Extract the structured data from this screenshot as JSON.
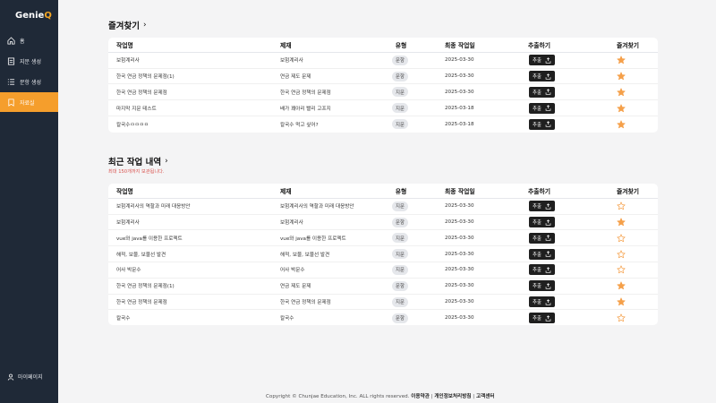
{
  "app": {
    "logo_main": "Genie",
    "logo_accent": "Q"
  },
  "sidebar": {
    "items": [
      {
        "label": "홈",
        "icon": "home-icon"
      },
      {
        "label": "지문 생성",
        "icon": "document-icon"
      },
      {
        "label": "문항 생성",
        "icon": "list-icon"
      },
      {
        "label": "자료실",
        "icon": "bookmark-icon",
        "active": true
      }
    ],
    "mypage": "마이페이지"
  },
  "favorites": {
    "title": "즐겨찾기",
    "headers": {
      "name": "작업명",
      "title": "제재",
      "type": "유형",
      "date": "최종 작업일",
      "export": "추출하기",
      "fav": "즐겨찾기"
    },
    "rows": [
      {
        "name": "보험계리사",
        "title": "보험계리사",
        "type": "문항",
        "date": "2025-03-30",
        "export": "추출",
        "fav": true
      },
      {
        "name": "한국 연금 정책의 문제점(1)",
        "title": "연금 제도 문제",
        "type": "문항",
        "date": "2025-03-30",
        "export": "추출",
        "fav": true
      },
      {
        "name": "한국 연금 정책의 문제점",
        "title": "한국 연금 정책의 문제점",
        "type": "지문",
        "date": "2025-03-30",
        "export": "추출",
        "fav": true
      },
      {
        "name": "마지막 지문 테스트",
        "title": "배가 꽤아리 빨리 고프지",
        "type": "지문",
        "date": "2025-03-18",
        "export": "추출",
        "fav": true
      },
      {
        "name": "칼국수ㅁㅁㅁㅁ",
        "title": "칼국수 먹고 싶어?",
        "type": "지문",
        "date": "2025-03-18",
        "export": "추출",
        "fav": true
      }
    ]
  },
  "recent": {
    "title": "최근 작업 내역",
    "note": "최대 150개까지 보관됩니다.",
    "headers": {
      "name": "작업명",
      "title": "제재",
      "type": "유형",
      "date": "최종 작업일",
      "export": "추출하기",
      "fav": "즐겨찾기"
    },
    "rows": [
      {
        "name": "보험계리사의 역할과 미래 대응방안",
        "title": "보험계리사의 역할과 미래 대응방안",
        "type": "지문",
        "date": "2025-03-30",
        "export": "추출",
        "fav": false
      },
      {
        "name": "보험계리사",
        "title": "보험계리사",
        "type": "문항",
        "date": "2025-03-30",
        "export": "추출",
        "fav": true
      },
      {
        "name": "vue와 java를 이용한 프로젝트",
        "title": "vue와 java를 이용한 프로젝트",
        "type": "지문",
        "date": "2025-03-30",
        "export": "추출",
        "fav": false
      },
      {
        "name": "해적, 보물, 보물선 발견",
        "title": "해적, 보물, 보물선 발견",
        "type": "지문",
        "date": "2025-03-30",
        "export": "추출",
        "fav": false
      },
      {
        "name": "어사 박문수",
        "title": "어사 박문수",
        "type": "지문",
        "date": "2025-03-30",
        "export": "추출",
        "fav": false
      },
      {
        "name": "한국 연금 정책의 문제점(1)",
        "title": "연금 제도 문제",
        "type": "문항",
        "date": "2025-03-30",
        "export": "추출",
        "fav": true
      },
      {
        "name": "한국 연금 정책의 문제점",
        "title": "한국 연금 정책의 문제점",
        "type": "지문",
        "date": "2025-03-30",
        "export": "추출",
        "fav": true
      },
      {
        "name": "칼국수",
        "title": "칼국수",
        "type": "문항",
        "date": "2025-03-30",
        "export": "추출",
        "fav": false
      }
    ]
  },
  "footer": {
    "copyright": "Copyright © Chunjae Education, Inc. ALL rights reserved.",
    "links": [
      "이용약관",
      "개인정보처리방침",
      "고객센터"
    ]
  },
  "colors": {
    "accent": "#f59e2c",
    "sidebar": "#1f2937",
    "star": "#f5a04a"
  }
}
